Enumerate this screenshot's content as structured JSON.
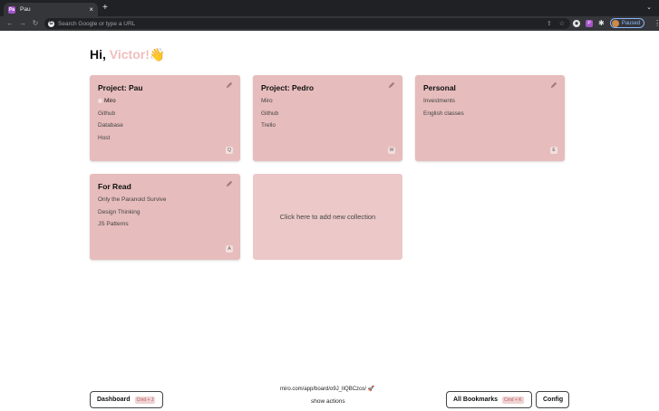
{
  "browser": {
    "tab_title": "Pau",
    "favicon_text": "Pa",
    "new_tab": "+",
    "tab_search": "⌄",
    "address_placeholder": "Search Google or type a URL",
    "profile_status": "Paused"
  },
  "greeting": {
    "prefix": "Hi, ",
    "name": "Victor!",
    "emoji": "👋"
  },
  "collections": [
    {
      "title": "Project: Pau",
      "links": [
        "Miro",
        "Github",
        "Database",
        "Host"
      ],
      "active_link": "Miro",
      "shortcut": "Q"
    },
    {
      "title": "Project: Pedro",
      "links": [
        "Miro",
        "Github",
        "Trello"
      ],
      "shortcut": "W"
    },
    {
      "title": "Personal",
      "links": [
        "Investments",
        "English classes"
      ],
      "shortcut": "E"
    },
    {
      "title": "For Read",
      "links": [
        "Only the Paranoid Survive",
        "Design Thinking",
        "JS Patterns"
      ],
      "shortcut": "A"
    }
  ],
  "add_collection_label": "Click here to add new collection",
  "footer": {
    "dashboard_label": "Dashboard",
    "dashboard_kbd": "Cmd + J",
    "current_url": "miro.com/app/board/o9J_lIQBCzco/ 🚀",
    "show_actions": "show actions",
    "all_bookmarks_label": "All Bookmarks",
    "all_bookmarks_kbd": "Cmd + K",
    "config_label": "Config"
  },
  "colors": {
    "card": "#e6bcbc",
    "add_card": "#ecc8c8",
    "accent_name": "#f0bdbd"
  }
}
